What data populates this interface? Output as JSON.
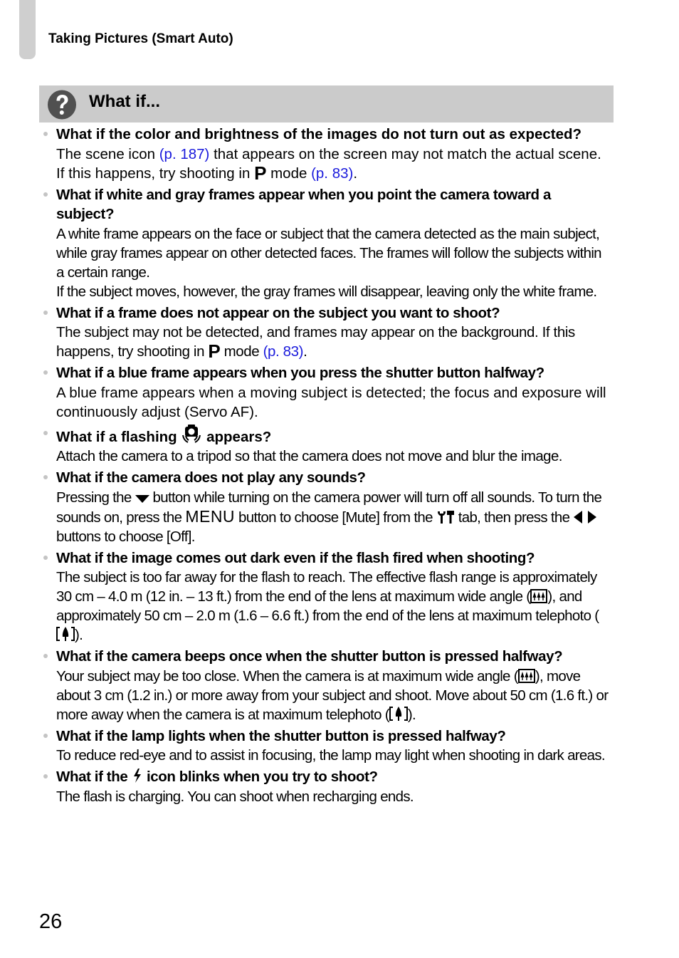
{
  "header": {
    "section_title": "Taking Pictures (Smart Auto)"
  },
  "whatif": {
    "title": "What if...",
    "icon": "question-circle-icon"
  },
  "items": [
    {
      "question": "What if the color and brightness of the images do not turn out as expected?",
      "answer": {
        "t1": "The scene icon ",
        "link1": "(p. 187)",
        "t2": " that appears on the screen may not match the actual scene. If this happens, try shooting in ",
        "mode": "P",
        "t3": " mode ",
        "link2": "(p. 83)",
        "t4": "."
      }
    },
    {
      "question": "What if white and gray frames appear when you point the camera toward a subject?",
      "answer": {
        "p1": "A white frame appears on the face or subject that the camera detected as the main subject, while gray frames appear on other detected faces. The frames will follow the subjects within a certain range.",
        "p2": "If the subject moves, however, the gray frames will disappear, leaving only the white frame."
      }
    },
    {
      "question": "What if a frame does not appear on the subject you want to shoot?",
      "answer": {
        "t1": "The subject may not be detected, and frames may appear on the background. If this happens, try shooting in ",
        "mode": "P",
        "t2": " mode ",
        "link": "(p. 83)",
        "t3": "."
      }
    },
    {
      "question": "What if a blue frame appears when you press the shutter button halfway?",
      "answer": "A blue frame appears when a moving subject is detected; the focus and exposure will continuously adjust (Servo AF)."
    },
    {
      "question": {
        "t1": "What if a flashing ",
        "icon": "camera-shake-icon",
        "t2": " appears?"
      },
      "answer": "Attach the camera to a tripod so that the camera does not move and blur the image."
    },
    {
      "question": "What if the camera does not play any sounds?",
      "answer": {
        "t1": "Pressing the ",
        "icon1": "down-arrow-button-icon",
        "t2": " button while turning on the camera power will turn off all sounds. To turn the sounds on, press the ",
        "menu": "MENU",
        "t3": " button to choose [Mute] from the ",
        "icon2": "tools-tab-icon",
        "t4": " tab, then press the ",
        "icon3": "left-right-arrows-icon",
        "t5": " buttons to choose [Off]."
      }
    },
    {
      "question": "What if the image comes out dark even if the flash fired when shooting?",
      "answer": {
        "t1": "The subject is too far away for the flash to reach. The effective flash range is approximately 30 cm – 4.0 m (12 in. – 13 ft.) from the end of the lens at maximum wide angle (",
        "icon1": "wide-angle-icon",
        "t2": "), and approximately 50 cm – 2.0 m (1.6 – 6.6 ft.) from the end of the lens at maximum telephoto (",
        "icon2": "telephoto-icon",
        "t3": ")."
      }
    },
    {
      "question": "What if the camera beeps once when the shutter button is pressed halfway?",
      "answer": {
        "t1": "Your subject may be too close. When the camera is at maximum wide angle (",
        "icon1": "wide-angle-icon",
        "t2": "), move about 3 cm (1.2 in.) or more away from your subject and shoot. Move about 50 cm (1.6 ft.) or more away when the camera is at maximum telephoto (",
        "icon2": "telephoto-icon",
        "t3": ")."
      }
    },
    {
      "question": "What if the lamp lights when the shutter button is pressed halfway?",
      "answer": "To reduce red-eye and to assist in focusing, the lamp may light when shooting in dark areas."
    },
    {
      "question": {
        "t1": "What if the ",
        "icon": "flash-icon",
        "t2": " icon blinks when you try to shoot?"
      },
      "answer": "The flash is charging. You can shoot when recharging ends."
    }
  ],
  "colors": {
    "link": "#1a1adc",
    "header_bar": "#cbcbcb",
    "tab_marker": "#cfcfcf",
    "bullet": "#c4c4c4"
  },
  "footer": {
    "page_number": "26"
  }
}
